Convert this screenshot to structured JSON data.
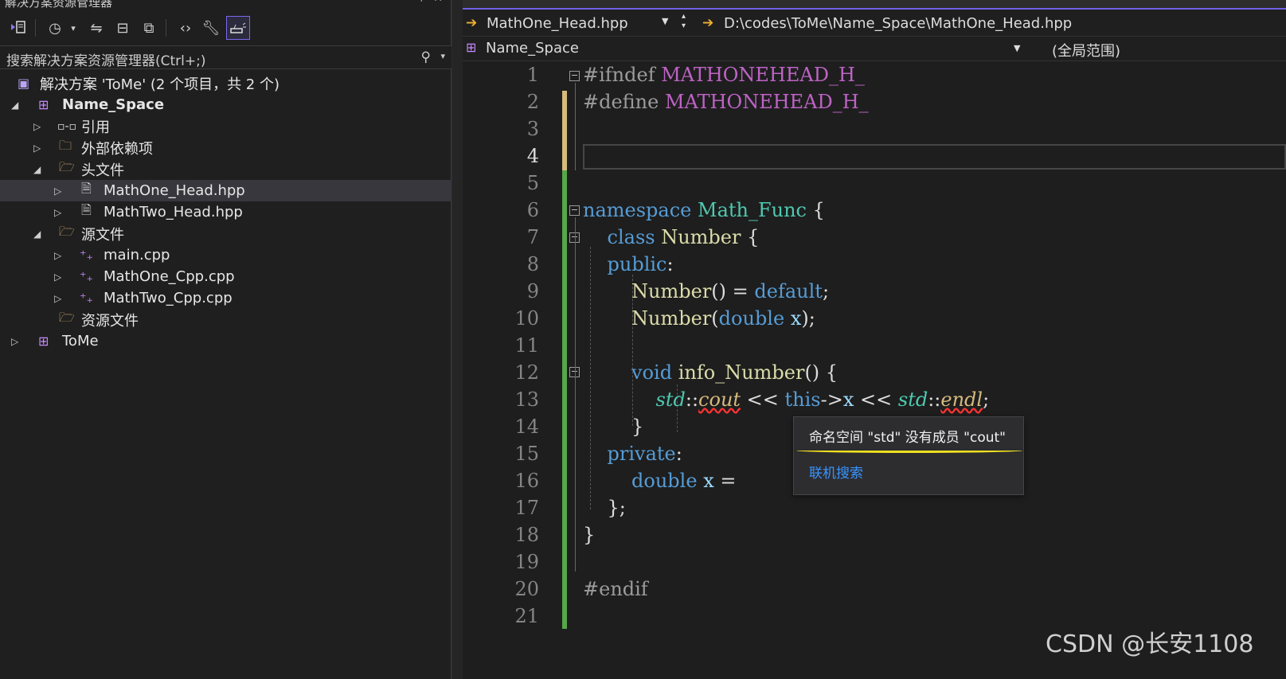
{
  "solution_explorer": {
    "title": "解决方案资源管理器",
    "search_placeholder": "搜索解决方案资源管理器(Ctrl+;)",
    "tree": [
      {
        "label": "解决方案 'ToMe' (2 个项目，共 2 个)",
        "icon": "solution-icon"
      },
      {
        "label": "Name_Space",
        "icon": "project-icon",
        "bold": true
      },
      {
        "label": "引用",
        "icon": "references-icon"
      },
      {
        "label": "外部依赖项",
        "icon": "external-deps-icon"
      },
      {
        "label": "头文件",
        "icon": "filter-folder-icon"
      },
      {
        "label": "MathOne_Head.hpp",
        "icon": "header-file-icon",
        "selected": true
      },
      {
        "label": "MathTwo_Head.hpp",
        "icon": "header-file-icon"
      },
      {
        "label": "源文件",
        "icon": "filter-folder-icon"
      },
      {
        "label": "main.cpp",
        "icon": "cpp-file-icon"
      },
      {
        "label": "MathOne_Cpp.cpp",
        "icon": "cpp-file-icon"
      },
      {
        "label": "MathTwo_Cpp.cpp",
        "icon": "cpp-file-icon"
      },
      {
        "label": "资源文件",
        "icon": "filter-folder-icon"
      },
      {
        "label": "ToMe",
        "icon": "project-icon"
      }
    ]
  },
  "editor": {
    "file_dropdown": "MathOne_Head.hpp",
    "file_path": "D:\\codes\\ToMe\\Name_Space\\MathOne_Head.hpp",
    "project_dropdown": "Name_Space",
    "scope_dropdown": "(全局范围)",
    "line_numbers": [
      "1",
      "2",
      "3",
      "4",
      "5",
      "6",
      "7",
      "8",
      "9",
      "10",
      "11",
      "12",
      "13",
      "14",
      "15",
      "16",
      "17",
      "18",
      "19",
      "20",
      "21"
    ],
    "current_line": "4"
  },
  "tooltip": {
    "message": "命名空间 \"std\" 没有成员 \"cout\"",
    "link": "联机搜索"
  },
  "watermark": "CSDN @长安1108",
  "colors": {
    "accent": "#7160e8",
    "change_bar": "#57a64a",
    "error_underline": "#ff3333",
    "highlight": "#f0e020"
  }
}
